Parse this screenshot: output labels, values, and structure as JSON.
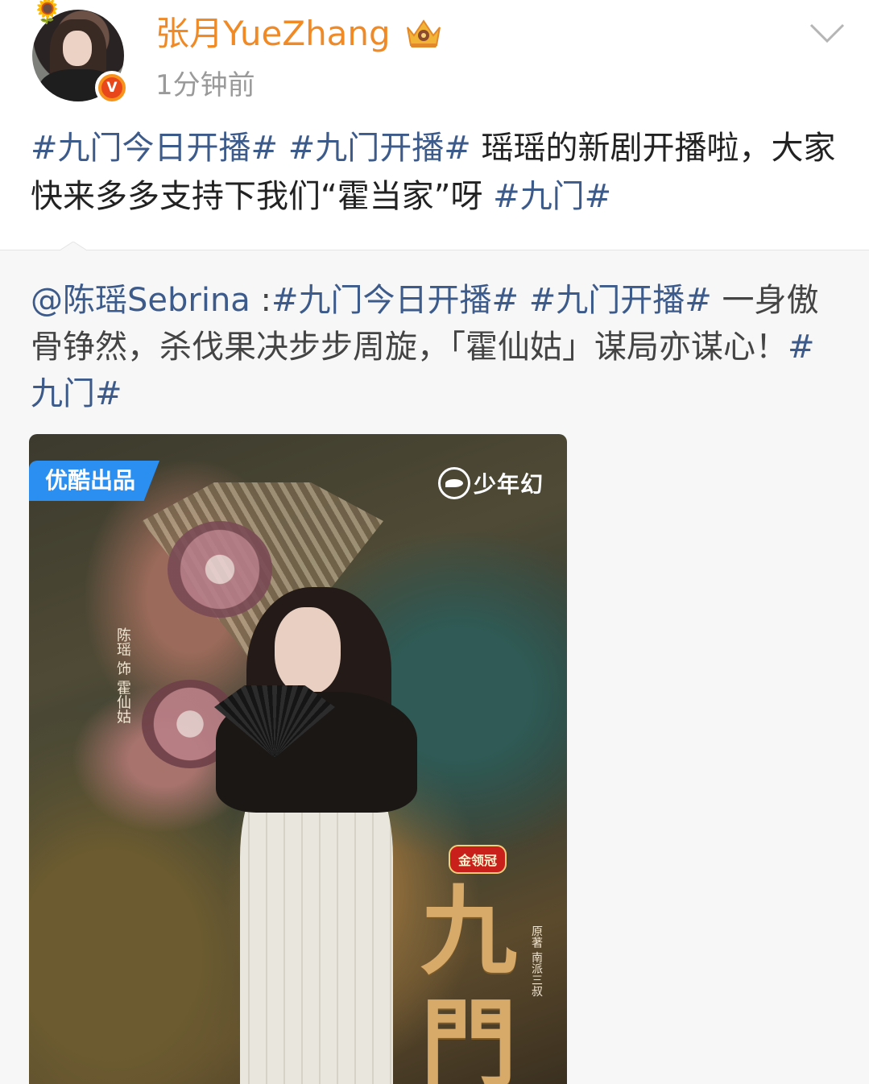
{
  "post": {
    "username": "张月YueZhang",
    "timestamp": "1分钟前",
    "badge_letter": "V",
    "avatar_emoji": "🌻",
    "text_segments": [
      {
        "text": "#九门今日开播#",
        "type": "tag"
      },
      {
        "text": " ",
        "type": "plain"
      },
      {
        "text": "#九门开播#",
        "type": "tag"
      },
      {
        "text": " 瑶瑶的新剧开播啦，大家快来多多支持下我们“霍当家”呀 ",
        "type": "plain"
      },
      {
        "text": "#九门#",
        "type": "tag"
      }
    ]
  },
  "repost": {
    "text_segments": [
      {
        "text": "@陈瑶Sebrina",
        "type": "tag"
      },
      {
        "text": " :",
        "type": "plain"
      },
      {
        "text": "#九门今日开播#",
        "type": "tag"
      },
      {
        "text": " ",
        "type": "plain"
      },
      {
        "text": "#九门开播#",
        "type": "tag"
      },
      {
        "text": " 一身傲骨铮然，杀伐果决步步周旋，「霍仙姑」谋局亦谋心！",
        "type": "plain"
      },
      {
        "text": "#九门#",
        "type": "tag"
      }
    ],
    "image": {
      "badge": "优酷出品",
      "studio": "少年幻",
      "cast_text": "陈瑶 饰 霍仙姑",
      "sponsor": "金领冠",
      "title": "九門",
      "author_text": "原著 南派三叔"
    }
  },
  "colors": {
    "username": "#f08a26",
    "hashtag": "#3d5b8a",
    "body_text": "#222222",
    "timestamp": "#9a9a9a",
    "repost_bg": "#f7f7f7",
    "badge_bg": "#2b8ff2"
  }
}
